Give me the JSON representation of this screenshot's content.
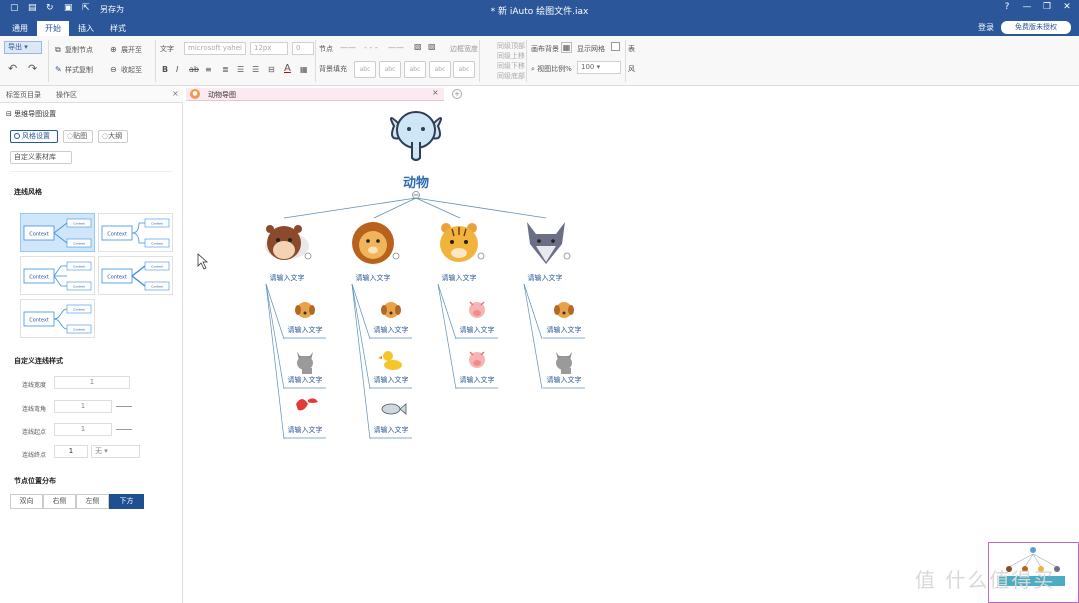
{
  "titlebar": {
    "save_as": "另存为",
    "document_title": "* 新 iAuto 绘图文件.iax",
    "window_controls": [
      "?",
      "—",
      "❐",
      "✕"
    ]
  },
  "menu": {
    "tabs": [
      "通用",
      "开始",
      "插入",
      "样式"
    ],
    "active_tab": "开始",
    "login": "登录",
    "trial_button": "免费版未授权"
  },
  "ribbon": {
    "export": "导出",
    "copy_node": "复制节点",
    "expand": "展开至",
    "collapse": "收起至",
    "format_copy": "样式复制",
    "text_label": "文字",
    "font_name": "microsoft yahei",
    "font_size": "12px",
    "zero_value": "0",
    "node_label": "节点",
    "border_width": "边框宽度",
    "background_fill": "背景填充",
    "swatch_text": "abc",
    "align_top": "同级顶部",
    "align_up": "同级上移",
    "align_down": "同级下移",
    "align_bottom": "同级底部",
    "canvas_bg": "画布背景",
    "show_grid": "显示网格",
    "view_scale": "视图比例%",
    "scale_value": "100",
    "table_text": "表",
    "style_text": "风"
  },
  "left_panel": {
    "tabs": [
      "标签页目录",
      "操作区"
    ],
    "section_title": "思维导图设置",
    "mode_buttons": [
      "风格设置",
      "贴图",
      "大纲"
    ],
    "custom_library": "自定义素材库",
    "line_style_title": "连线风格",
    "thumb_center": "Context",
    "thumb_child": "Context",
    "custom_line_title": "自定义连线样式",
    "form": [
      {
        "label": "连线宽度",
        "value": "1"
      },
      {
        "label": "连线弯角",
        "value": "1"
      },
      {
        "label": "连线起点",
        "value": "1"
      },
      {
        "label": "连线终点",
        "value": "1"
      }
    ],
    "end_select": "无",
    "layout_title": "节点位置分布",
    "layout_options": [
      "双向",
      "右侧",
      "左侧",
      "下方"
    ],
    "layout_selected": "下方"
  },
  "document_tab": {
    "label": "动物导图"
  },
  "mindmap": {
    "root_label": "动物",
    "placeholder": "请输入文字",
    "categories": [
      {
        "animal": "hamster",
        "children": [
          "dog",
          "cat",
          "bird"
        ]
      },
      {
        "animal": "lion",
        "children": [
          "dog",
          "duck",
          "fish"
        ]
      },
      {
        "animal": "tiger",
        "children": [
          "pig",
          "pig"
        ]
      },
      {
        "animal": "wolf",
        "children": [
          "dog",
          "cat"
        ]
      }
    ]
  },
  "watermark": "值 什么值得买"
}
